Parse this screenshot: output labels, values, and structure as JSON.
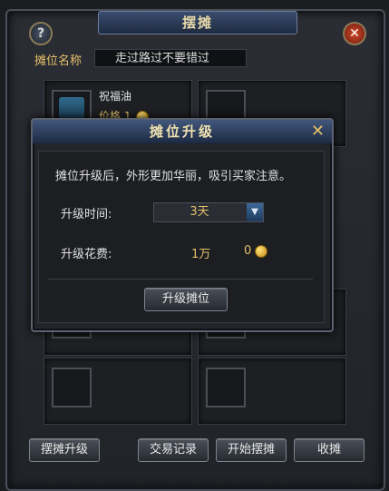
{
  "window": {
    "title": "摆摊",
    "help": "?",
    "close": "✕"
  },
  "stall": {
    "name_label": "摊位名称",
    "name_value": "走过路过不要错过"
  },
  "items": [
    {
      "name": "祝福油",
      "price_label": "价格",
      "price": "1"
    }
  ],
  "buttons": {
    "upgrade_stall": "摆摊升级",
    "trade_log": "交易记录",
    "start": "开始摆摊",
    "close_stall": "收摊"
  },
  "modal": {
    "title": "摊位升级",
    "close": "✕",
    "notice": "摊位升级后，外形更加华丽，吸引买家注意。",
    "time_label": "升级时间:",
    "time_value": "3天",
    "cost_label": "升级花费:",
    "cost_primary": "1万",
    "cost_coin": "0",
    "confirm": "升级摊位"
  }
}
